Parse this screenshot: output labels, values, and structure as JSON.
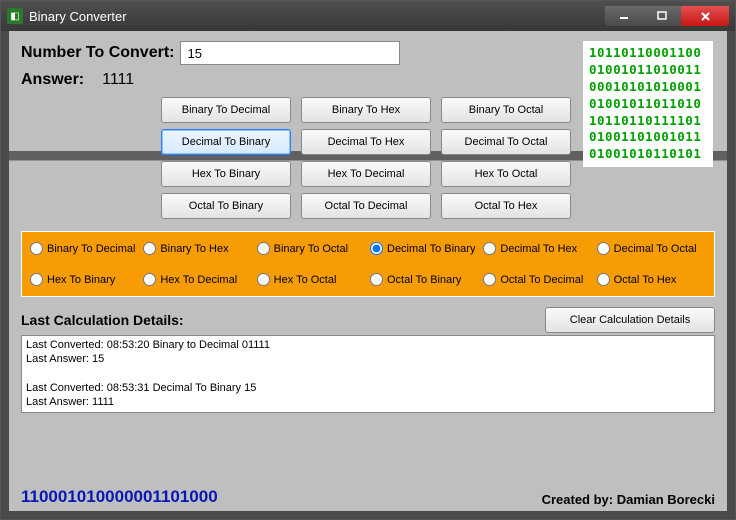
{
  "title": "Binary Converter",
  "labels": {
    "numberToConvert": "Number To Convert:",
    "answer": "Answer:",
    "lastCalcDetails": "Last Calculation Details:",
    "clearDetails": "Clear Calculation Details",
    "createdBy": "Created by: Damian Borecki"
  },
  "input": {
    "value": "15"
  },
  "answerValue": "1111",
  "buttons": [
    {
      "label": "Binary To Decimal",
      "selected": false
    },
    {
      "label": "Binary To Hex",
      "selected": false
    },
    {
      "label": "Binary To Octal",
      "selected": false
    },
    {
      "label": "Decimal To Binary",
      "selected": true
    },
    {
      "label": "Decimal To Hex",
      "selected": false
    },
    {
      "label": "Decimal To Octal",
      "selected": false
    },
    {
      "label": "Hex To Binary",
      "selected": false
    },
    {
      "label": "Hex To Decimal",
      "selected": false
    },
    {
      "label": "Hex To Octal",
      "selected": false
    },
    {
      "label": "Octal To Binary",
      "selected": false
    },
    {
      "label": "Octal To Decimal",
      "selected": false
    },
    {
      "label": "Octal To Hex",
      "selected": false
    }
  ],
  "radios": [
    {
      "label": "Binary To Decimal",
      "checked": false
    },
    {
      "label": "Binary To Hex",
      "checked": false
    },
    {
      "label": "Binary To Octal",
      "checked": false
    },
    {
      "label": "Decimal To Binary",
      "checked": true
    },
    {
      "label": "Decimal To Hex",
      "checked": false
    },
    {
      "label": "Decimal To Octal",
      "checked": false
    },
    {
      "label": "Hex To Binary",
      "checked": false
    },
    {
      "label": "Hex To Decimal",
      "checked": false
    },
    {
      "label": "Hex To Octal",
      "checked": false
    },
    {
      "label": "Octal To Binary",
      "checked": false
    },
    {
      "label": "Octal To Decimal",
      "checked": false
    },
    {
      "label": "Octal To Hex",
      "checked": false
    }
  ],
  "binaryArt": [
    "10110110001100",
    "01001011010011",
    "00010101010001",
    "01001011011010",
    "10110110111101",
    "01001101001011",
    "01001010110101"
  ],
  "details": "Last Converted: 08:53:20  Binary to Decimal 01111\nLast Answer: 15\n\nLast Converted: 08:53:31  Decimal To Binary 15\nLast Answer: 1111",
  "footerBinary": "110001010000001101000"
}
